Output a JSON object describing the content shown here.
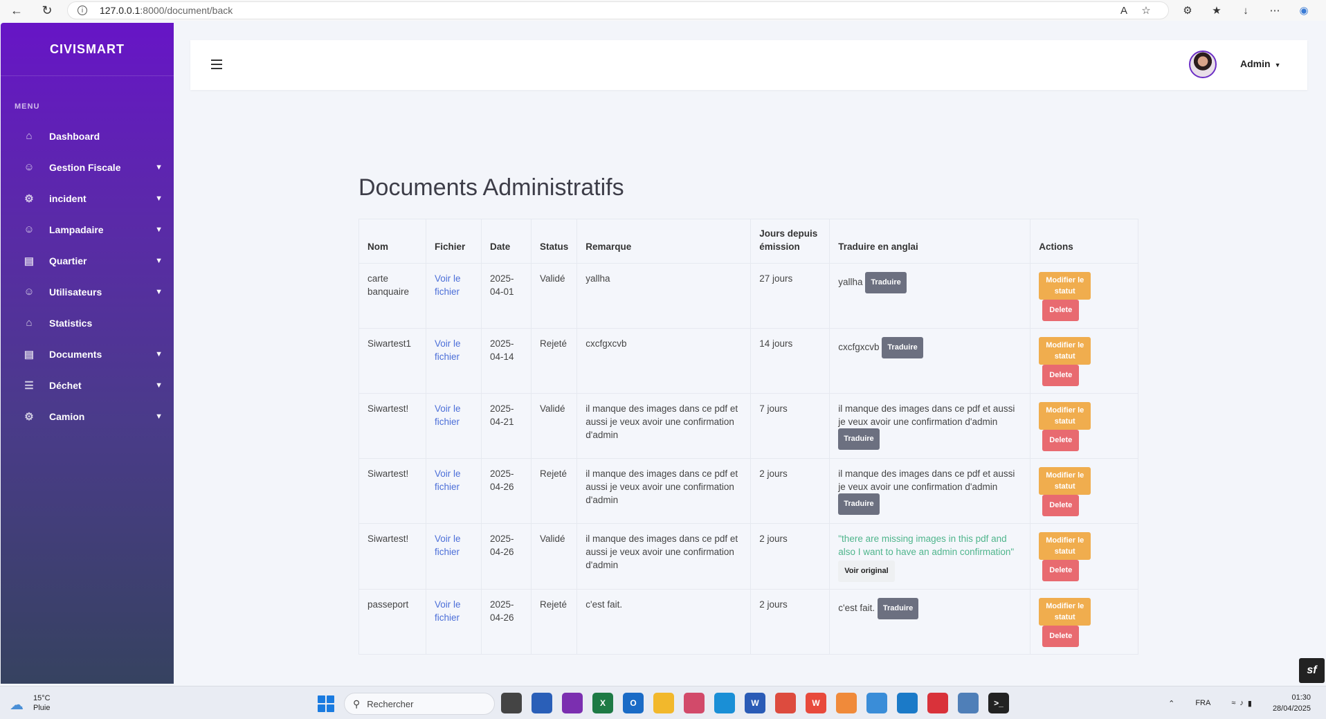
{
  "browser": {
    "url_host": "127.0.0.1",
    "url_path": ":8000/document/back"
  },
  "sidebar": {
    "brand": "CIVISMART",
    "menu_label": "MENU",
    "items": [
      {
        "label": "Dashboard",
        "icon": "home-icon",
        "dropdown": false
      },
      {
        "label": "Gestion Fiscale",
        "icon": "user-icon",
        "dropdown": true
      },
      {
        "label": "incident",
        "icon": "gear-icon",
        "dropdown": true
      },
      {
        "label": "Lampadaire",
        "icon": "user-icon",
        "dropdown": true
      },
      {
        "label": "Quartier",
        "icon": "briefcase-icon",
        "dropdown": true
      },
      {
        "label": "Utilisateurs",
        "icon": "user-icon",
        "dropdown": true
      },
      {
        "label": "Statistics",
        "icon": "home-icon",
        "dropdown": false
      },
      {
        "label": "Documents",
        "icon": "briefcase-icon",
        "dropdown": true
      },
      {
        "label": "Déchet",
        "icon": "document-icon",
        "dropdown": true
      },
      {
        "label": "Camion",
        "icon": "gear-icon",
        "dropdown": true
      }
    ]
  },
  "header": {
    "user_name": "Admin"
  },
  "main": {
    "title": "Documents Administratifs",
    "columns": [
      "Nom",
      "Fichier",
      "Date",
      "Status",
      "Remarque",
      "Jours depuis émission",
      "Traduire en anglai",
      "Actions"
    ],
    "rows": [
      {
        "nom": "carte banquaire",
        "fichier": "Voir le fichier",
        "date": "2025-04-01",
        "status": "Validé",
        "remarque": "yallha",
        "jours": "27 jours",
        "traduction": "yallha",
        "translated": false,
        "btn": "Traduire"
      },
      {
        "nom": "Siwartest1",
        "fichier": "Voir le fichier",
        "date": "2025-04-14",
        "status": "Rejeté",
        "remarque": "cxcfgxcvb",
        "jours": "14 jours",
        "traduction": "cxcfgxcvb",
        "translated": false,
        "btn": "Traduire"
      },
      {
        "nom": "Siwartest!",
        "fichier": "Voir le fichier",
        "date": "2025-04-21",
        "status": "Validé",
        "remarque": "il manque des images dans ce pdf et aussi je veux avoir une confirmation d'admin",
        "jours": "7 jours",
        "traduction": "il manque des images dans ce pdf et aussi je veux avoir une confirmation d'admin",
        "translated": false,
        "btn": "Traduire"
      },
      {
        "nom": "Siwartest!",
        "fichier": "Voir le fichier",
        "date": "2025-04-26",
        "status": "Rejeté",
        "remarque": "il manque des images dans ce pdf et aussi je veux avoir une confirmation d'admin",
        "jours": "2 jours",
        "traduction": "il manque des images dans ce pdf et aussi je veux avoir une confirmation d'admin",
        "translated": false,
        "btn": "Traduire"
      },
      {
        "nom": "Siwartest!",
        "fichier": "Voir le fichier",
        "date": "2025-04-26",
        "status": "Validé",
        "remarque": "il manque des images dans ce pdf et aussi je veux avoir une confirmation d'admin",
        "jours": "2 jours",
        "traduction": "\"there are missing images in this pdf and also I want to have an admin confirmation\"",
        "translated": true,
        "btn": "Voir original"
      },
      {
        "nom": "passeport",
        "fichier": "Voir le fichier",
        "date": "2025-04-26",
        "status": "Rejeté",
        "remarque": "c'est fait.",
        "jours": "2 jours",
        "traduction": "c'est fait.",
        "translated": false,
        "btn": "Traduire"
      }
    ],
    "action_modify": "Modifier le statut",
    "action_delete": "Delete"
  },
  "taskbar": {
    "temperature": "15°C",
    "weather": "Pluie",
    "search_placeholder": "Rechercher",
    "language": "FRA",
    "time": "01:30",
    "date": "28/04/2025"
  },
  "colors": {
    "sidebar_top": "#6715c6",
    "sidebar_bottom": "#364260",
    "modify_button": "#f0ad4e",
    "delete_button": "#e86a70",
    "translate_button": "#6c7080",
    "translated_text": "#4fb58c",
    "link": "#4b6ed8"
  }
}
